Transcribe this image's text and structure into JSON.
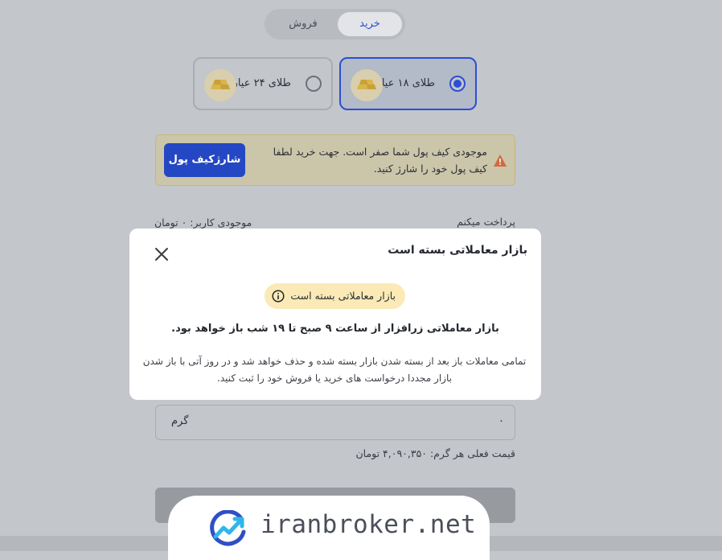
{
  "tabs": {
    "buy": "خرید",
    "sell": "فروش"
  },
  "gold": {
    "k18": "طلای ۱۸ عیار",
    "k24": "طلای ۲۴ عیار"
  },
  "warning": {
    "text": "موجودی کیف پول شما صفر است. جهت خرید لطفا کیف پول خود را شارژ کنید.",
    "button": "شارژکیف پول"
  },
  "form": {
    "pay_label": "پرداخت میکنم",
    "balance_label": "موجودی کاربر: ۰ تومان",
    "gram_value": "۰",
    "gram_unit": "گرم",
    "price_label": "قیمت فعلی هر گرم: ۴,۰۹۰,۳۵۰ تومان"
  },
  "modal": {
    "title": "بازار معاملاتی بسته است",
    "badge": "بازار معاملاتی بسته است",
    "message": "بازار معاملاتی زرافزار از ساعت ۹ صبح تا ۱۹ شب باز خواهد بود.",
    "description": "تمامی معاملات باز بعد از بسته شدن بازار بسته شده و حذف خواهد شد و در روز آتی با باز شدن بازار مجددا درخواست های خرید یا فروش خود را ثبت کنید."
  },
  "watermark": {
    "text": "iranbroker.net"
  },
  "colors": {
    "accent": "#2c4fd6",
    "warning_bg": "#fbeab6",
    "gold": "#d9b54a"
  }
}
